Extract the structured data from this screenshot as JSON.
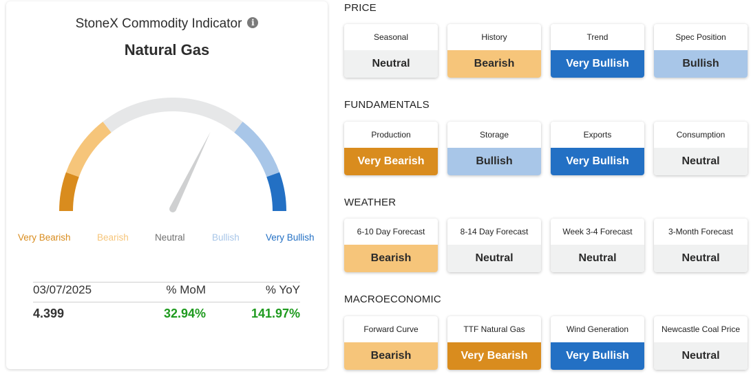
{
  "indicator": {
    "title": "StoneX Commodity Indicator",
    "info_icon": "info-circle-icon",
    "commodity": "Natural Gas"
  },
  "gauge": {
    "current_level": "Bullish",
    "labels": [
      "Very Bearish",
      "Bearish",
      "Neutral",
      "Bullish",
      "Very Bullish"
    ],
    "colors": {
      "very_bearish": "#d98c1e",
      "bearish": "#f6c57a",
      "neutral": "#e6e7e8",
      "bullish": "#a8c6e8",
      "very_bullish": "#2370c4",
      "needle": "#cfd0d1"
    }
  },
  "stats": {
    "date": "03/07/2025",
    "mom_label": "% MoM",
    "yoy_label": "% YoY",
    "price": "4.399",
    "mom": "32.94%",
    "yoy": "141.97%"
  },
  "sections": [
    {
      "title": "PRICE",
      "cards": [
        {
          "label": "Seasonal",
          "value": "Neutral",
          "status": "neutral"
        },
        {
          "label": "History",
          "value": "Bearish",
          "status": "bearish"
        },
        {
          "label": "Trend",
          "value": "Very Bullish",
          "status": "very-bullish"
        },
        {
          "label": "Spec Position",
          "value": "Bullish",
          "status": "bullish"
        }
      ]
    },
    {
      "title": "FUNDAMENTALS",
      "cards": [
        {
          "label": "Production",
          "value": "Very Bearish",
          "status": "very-bearish"
        },
        {
          "label": "Storage",
          "value": "Bullish",
          "status": "bullish"
        },
        {
          "label": "Exports",
          "value": "Very Bullish",
          "status": "very-bullish"
        },
        {
          "label": "Consumption",
          "value": "Neutral",
          "status": "neutral"
        }
      ]
    },
    {
      "title": "WEATHER",
      "cards": [
        {
          "label": "6-10 Day Forecast",
          "value": "Bearish",
          "status": "bearish"
        },
        {
          "label": "8-14 Day Forecast",
          "value": "Neutral",
          "status": "neutral"
        },
        {
          "label": "Week 3-4 Forecast",
          "value": "Neutral",
          "status": "neutral"
        },
        {
          "label": "3-Month Forecast",
          "value": "Neutral",
          "status": "neutral"
        }
      ]
    },
    {
      "title": "MACROECONOMIC",
      "cards": [
        {
          "label": "Forward Curve",
          "value": "Bearish",
          "status": "bearish"
        },
        {
          "label": "TTF Natural Gas",
          "value": "Very Bearish",
          "status": "very-bearish"
        },
        {
          "label": "Wind Generation",
          "value": "Very Bullish",
          "status": "very-bullish"
        },
        {
          "label": "Newcastle Coal Price",
          "value": "Neutral",
          "status": "neutral"
        }
      ]
    }
  ]
}
